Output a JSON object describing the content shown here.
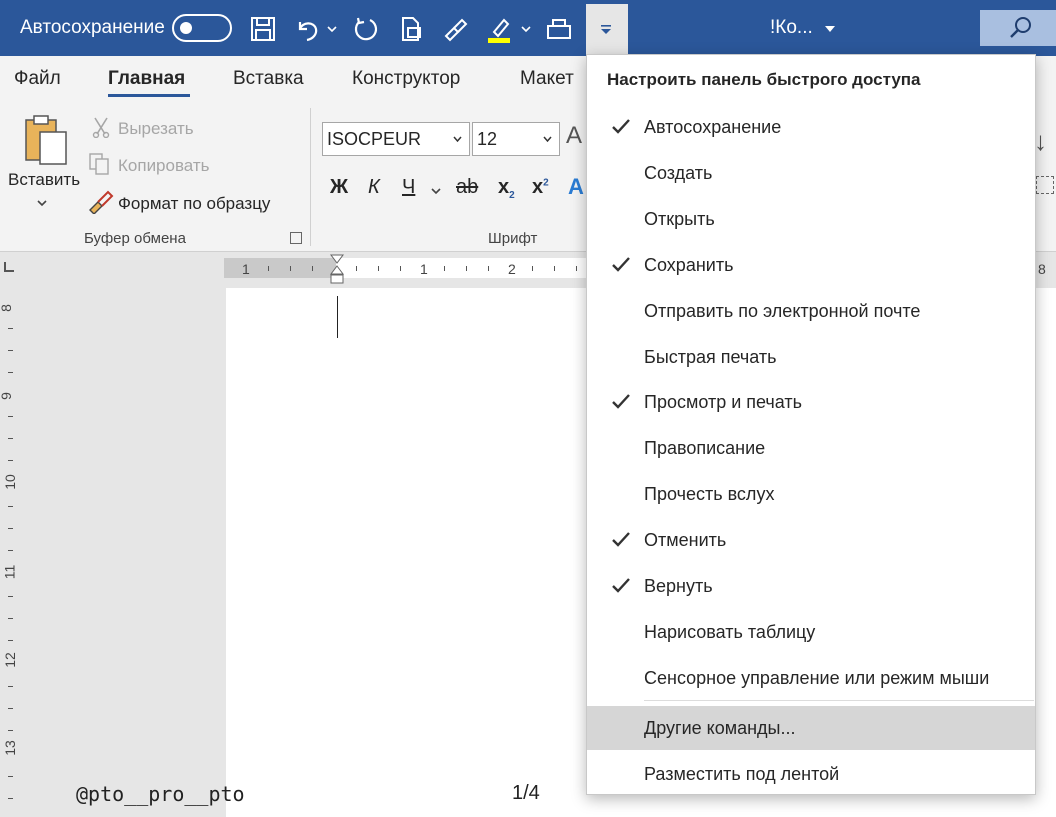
{
  "titlebar": {
    "autosave_label": "Автосохранение",
    "doc_title": "!Ко...",
    "colors": {
      "bar": "#2b579a",
      "highlight": "#ffff00"
    }
  },
  "tabs": [
    {
      "label": "Файл"
    },
    {
      "label": "Главная"
    },
    {
      "label": "Вставка"
    },
    {
      "label": "Конструктор"
    },
    {
      "label": "Макет"
    }
  ],
  "clipboard": {
    "paste_label": "Вставить",
    "cut_label": "Вырезать",
    "copy_label": "Копировать",
    "format_painter_label": "Формат по образцу",
    "group_label": "Буфер обмена"
  },
  "font": {
    "font_name": "ISOCPEUR",
    "font_size": "12",
    "bold": "Ж",
    "italic": "К",
    "underline": "Ч",
    "strike": "ab",
    "subscript": "x",
    "superscript": "x",
    "group_label": "Шрифт"
  },
  "ruler": {
    "h_numbers": [
      "1",
      "1",
      "2"
    ],
    "right_number": "8",
    "v_numbers": [
      "8",
      "9",
      "10",
      "11",
      "12",
      "13"
    ]
  },
  "document": {
    "watermark": "@pto__pro__pto",
    "page_number": "1/4"
  },
  "qat_menu": {
    "title": "Настроить панель быстрого доступа",
    "items": [
      {
        "label": "Автосохранение",
        "checked": true
      },
      {
        "label": "Создать",
        "checked": false
      },
      {
        "label": "Открыть",
        "checked": false
      },
      {
        "label": "Сохранить",
        "checked": true
      },
      {
        "label": "Отправить по электронной почте",
        "checked": false
      },
      {
        "label": "Быстрая печать",
        "checked": false
      },
      {
        "label": "Просмотр и печать",
        "checked": true
      },
      {
        "label": "Правописание",
        "checked": false
      },
      {
        "label": "Прочесть вслух",
        "checked": false
      },
      {
        "label": "Отменить",
        "checked": true
      },
      {
        "label": "Вернуть",
        "checked": true
      },
      {
        "label": "Нарисовать таблицу",
        "checked": false
      },
      {
        "label": "Сенсорное управление или режим мыши",
        "checked": false
      },
      {
        "label": "Другие команды...",
        "checked": false,
        "hovered": true
      },
      {
        "label": "Разместить под лентой",
        "checked": false
      }
    ]
  }
}
